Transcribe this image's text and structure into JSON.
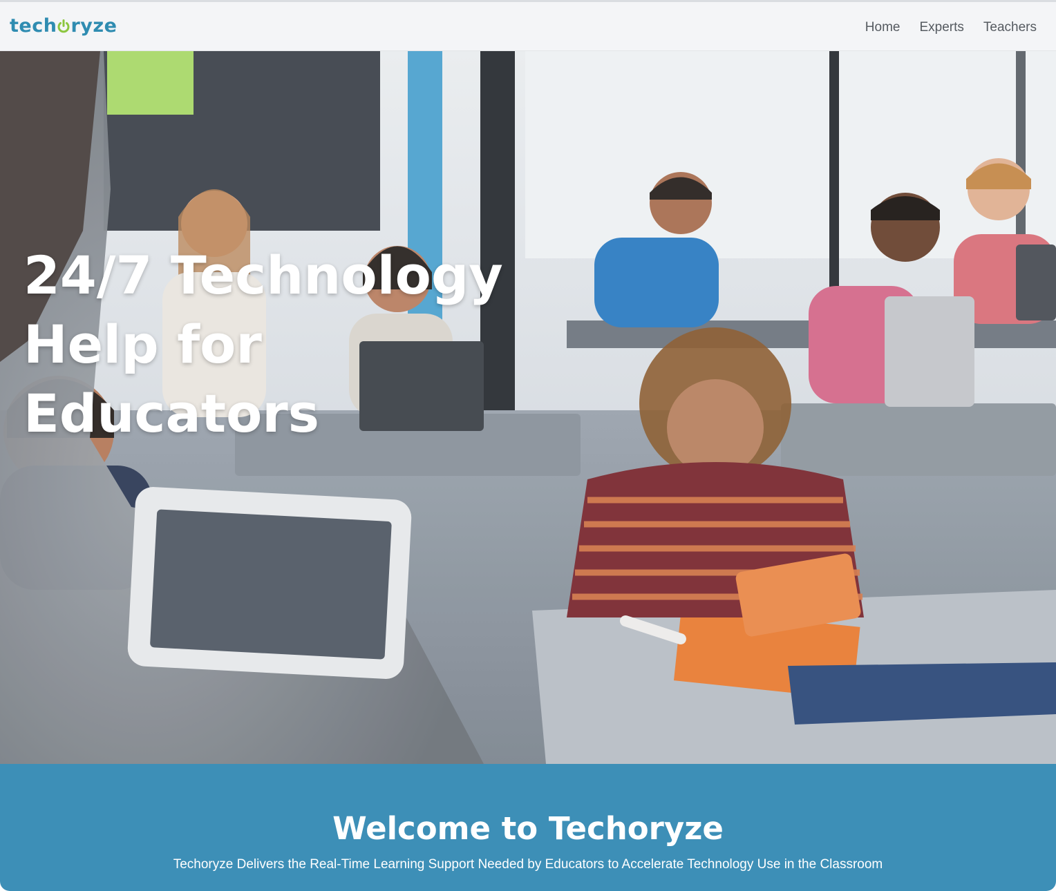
{
  "brand": {
    "logo_text_a": "tech",
    "logo_text_b": "ryze",
    "logo_icon": "power-icon",
    "primary_color": "#2f8cb1",
    "accent_color": "#8cc63f"
  },
  "nav": {
    "items": [
      {
        "label": "Home"
      },
      {
        "label": "Experts"
      },
      {
        "label": "Teachers"
      }
    ]
  },
  "hero": {
    "title_line1": "24/7 Technology",
    "title_line2": "Help for Educators",
    "image": "classroom-photo"
  },
  "welcome": {
    "title": "Welcome to Techoryze",
    "subtitle": "Techoryze Delivers the Real-Time Learning Support Needed by Educators to Accelerate Technology Use in the Classroom",
    "background_color": "#3d8fb7"
  }
}
